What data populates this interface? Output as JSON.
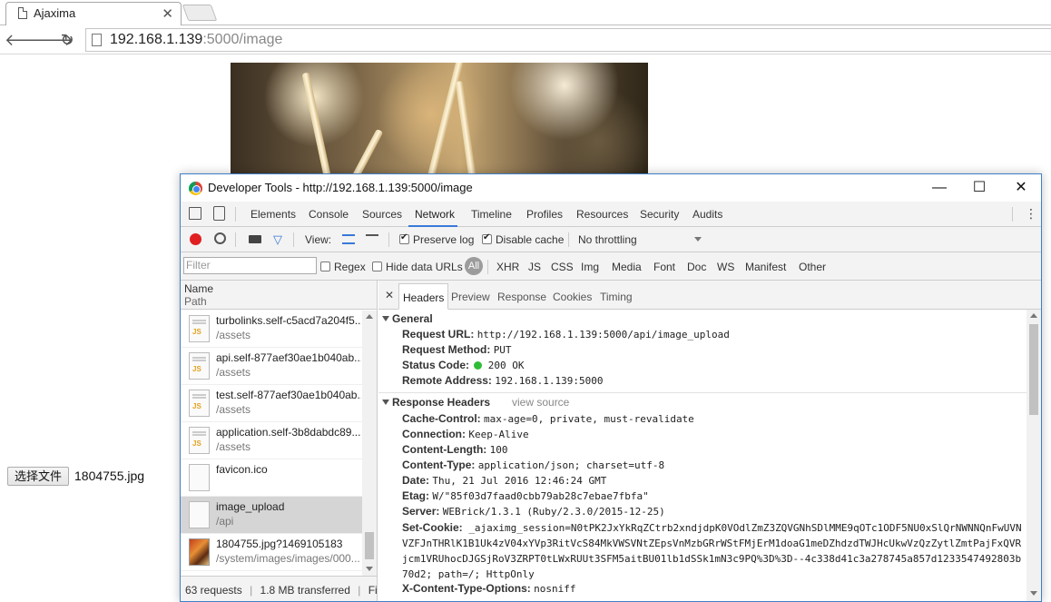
{
  "browser": {
    "tab_title": "Ajaxima",
    "url_host": "192.168.1.139",
    "url_rest": ":5000/image"
  },
  "page": {
    "file_button_label": "选择文件",
    "file_name": "1804755.jpg"
  },
  "devtools": {
    "window_title": "Developer Tools - http://192.168.1.139:5000/image",
    "panels": [
      "Elements",
      "Console",
      "Sources",
      "Network",
      "Timeline",
      "Profiles",
      "Resources",
      "Security",
      "Audits"
    ],
    "active_panel": "Network",
    "toolbar": {
      "view_label": "View:",
      "preserve_log": "Preserve log",
      "disable_cache": "Disable cache",
      "throttling": "No throttling"
    },
    "filter": {
      "placeholder": "Filter",
      "regex": "Regex",
      "hide_data_urls": "Hide data URLs",
      "all": "All",
      "types": [
        "XHR",
        "JS",
        "CSS",
        "Img",
        "Media",
        "Font",
        "Doc",
        "WS",
        "Manifest",
        "Other"
      ]
    },
    "list_header": {
      "name": "Name",
      "path": "Path"
    },
    "requests": [
      {
        "name": "turbolinks.self-c5acd7a204f5...",
        "path": "/assets",
        "type": "js"
      },
      {
        "name": "api.self-877aef30ae1b040ab...",
        "path": "/assets",
        "type": "js"
      },
      {
        "name": "test.self-877aef30ae1b040ab...",
        "path": "/assets",
        "type": "js"
      },
      {
        "name": "application.self-3b8dabdc89...",
        "path": "/assets",
        "type": "js"
      },
      {
        "name": "favicon.ico",
        "path": "",
        "type": "blank"
      },
      {
        "name": "image_upload",
        "path": "/api",
        "type": "blank"
      },
      {
        "name": "1804755.jpg?1469105183",
        "path": "/system/images/images/000...",
        "type": "img"
      }
    ],
    "status_bar": {
      "requests": "63 requests",
      "transferred": "1.8 MB transferred",
      "finish": "Fin..."
    },
    "detail_tabs": [
      "Headers",
      "Preview",
      "Response",
      "Cookies",
      "Timing"
    ],
    "general": {
      "title": "General",
      "request_url_k": "Request URL:",
      "request_url_v": "http://192.168.1.139:5000/api/image_upload",
      "method_k": "Request Method:",
      "method_v": "PUT",
      "status_k": "Status Code:",
      "status_v": "200 OK",
      "remote_k": "Remote Address:",
      "remote_v": "192.168.1.139:5000"
    },
    "response_headers": {
      "title": "Response Headers",
      "view_source": "view source",
      "cache_control_k": "Cache-Control:",
      "cache_control_v": "max-age=0, private, must-revalidate",
      "connection_k": "Connection:",
      "connection_v": "Keep-Alive",
      "content_length_k": "Content-Length:",
      "content_length_v": "100",
      "content_type_k": "Content-Type:",
      "content_type_v": "application/json; charset=utf-8",
      "date_k": "Date:",
      "date_v": "Thu, 21 Jul 2016 12:46:24 GMT",
      "etag_k": "Etag:",
      "etag_v": "W/\"85f03d7faad0cbb79ab28c7ebae7fbfa\"",
      "server_k": "Server:",
      "server_v": "WEBrick/1.3.1 (Ruby/2.3.0/2015-12-25)",
      "set_cookie_k": "Set-Cookie:",
      "set_cookie_v": "_ajaximg_session=N0tPK2JxYkRqZCtrb2xndjdpK0VOdlZmZ3ZQVGNhSDlMME9qOTc1ODF5NU0xSlQrNWNNQnFwUVNVZFJnTHRlK1B1Uk4zV04xYVp3RitVcS84MkVWSVNtZEpsVnMzbGRrWStFMjErM1doaG1meDZhdzdTWJHcUkwVzQzZytlZmtPajFxQVRjcm1VRUhocDJGSjRoV3ZRPT0tLWxRUUt3SFM5aitBU01lb1dSSk1mN3c9PQ%3D%3D--4c338d41c3a278745a857d1233547492803b70d2; path=/; HttpOnly",
      "xcto_k": "X-Content-Type-Options:",
      "xcto_v": "nosniff"
    },
    "colors": {
      "accent": "#3879d9",
      "record": "#e02020",
      "status_ok": "#2fbd36"
    }
  }
}
